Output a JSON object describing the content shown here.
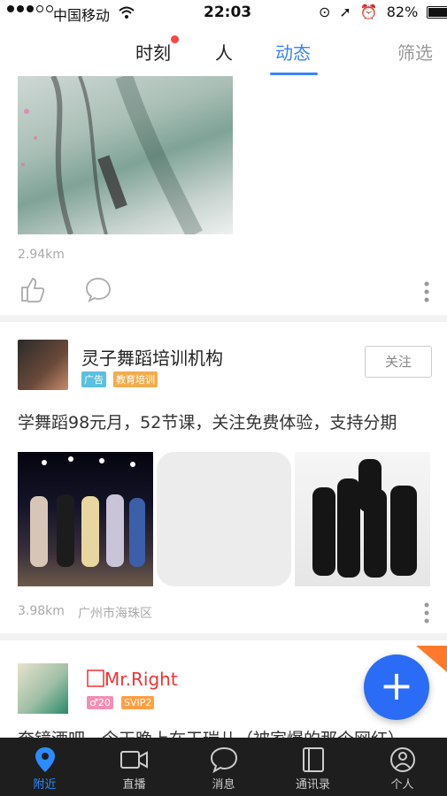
{
  "status_bar": {
    "carrier": "中国移动",
    "time": "22:03",
    "battery": "82%",
    "battery_level": 0.82
  },
  "top_tabs": {
    "items": [
      "时刻",
      "人",
      "动态"
    ],
    "active": "动态",
    "filter_label": "筛选"
  },
  "posts": [
    {
      "distance": "2.94km"
    },
    {
      "name": "灵子舞蹈培训机构",
      "tags": [
        "广告",
        "教育培训"
      ],
      "follow_label": "关注",
      "content": "学舞蹈98元月，52节课，关注免费体验，支持分期",
      "distance": "3.98km",
      "location": "广州市海珠区"
    },
    {
      "name": "Mr.Right",
      "badges": [
        "20",
        "SVIP2"
      ],
      "content": "奔镜酒吧，今天晚上在干瑞儿（被家爆的那个网红）"
    }
  ],
  "fab": {
    "symbol": "+"
  },
  "bottom_nav": {
    "items": [
      "附近",
      "直播",
      "消息",
      "通讯录",
      "个人"
    ],
    "active": "附近"
  },
  "colors": {
    "accent": "#3b82f6",
    "vip_name": "#e33333",
    "ad_tag": "#5bc0de",
    "category_tag": "#f0ad4e",
    "badge_pink": "#f48fb1",
    "badge_orange": "#ff9f43",
    "fab": "#2b6cf6",
    "bottom_bar": "#1e1e1e"
  }
}
